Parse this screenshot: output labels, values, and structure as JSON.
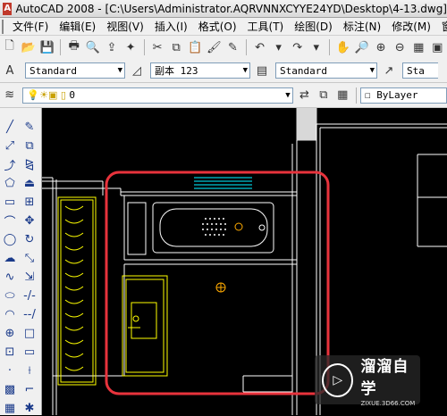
{
  "titlebar": {
    "title": "AutoCAD 2008 - [C:\\Users\\Administrator.AQRVNNXCYYE24YD\\Desktop\\4-13.dwg]",
    "icon": "autocad-icon"
  },
  "menubar": {
    "items": [
      "文件(F)",
      "编辑(E)",
      "视图(V)",
      "插入(I)",
      "格式(O)",
      "工具(T)",
      "绘图(D)",
      "标注(N)",
      "修改(M)",
      "窗"
    ]
  },
  "styles_toolbar": {
    "text_style": "Standard",
    "dim_style": "副本 123",
    "table_style": "Standard",
    "mleader_style": "Sta"
  },
  "layers_toolbar": {
    "layer_name": "0",
    "color": "ByLayer"
  },
  "watermark": {
    "brand": "溜溜自学",
    "url": "ZIXUE.3D66.COM"
  },
  "colors": {
    "highlight": "#e8333c",
    "cad_lines": "#ffffff",
    "fixture": "#ffff00",
    "window": "#00c8d8",
    "shower": "#ffaa00"
  }
}
